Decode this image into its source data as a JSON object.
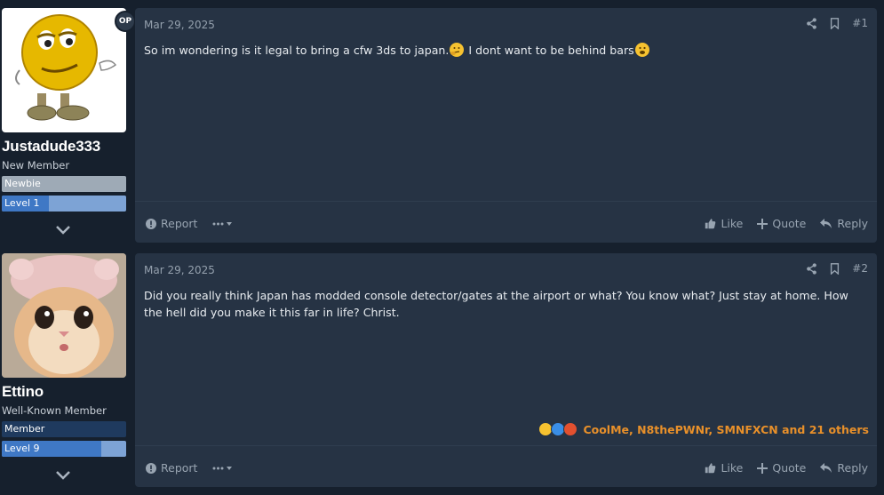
{
  "posts": [
    {
      "author": {
        "name": "Justadude333",
        "title": "New Member",
        "banner": "Newbie",
        "banner_color": "#9eaab6",
        "level": "Level 1",
        "level_progress": 0.38,
        "op_badge": "OP",
        "avatar": "yellow-smiley-avatar"
      },
      "date": "Mar 29, 2025",
      "number": "#1",
      "text_parts": [
        "So im wondering is it legal to bring a cfw 3ds to japan.",
        " I dont want to be behind bars"
      ],
      "reactions": null,
      "actions": {
        "report": "Report",
        "like": "Like",
        "quote": "Quote",
        "reply": "Reply"
      }
    },
    {
      "author": {
        "name": "Ettino",
        "title": "Well-Known Member",
        "banner": "Member",
        "banner_color": "#1f3a5e",
        "level": "Level 9",
        "level_progress": 0.8,
        "op_badge": "",
        "avatar": "cat-avatar"
      },
      "date": "Mar 29, 2025",
      "number": "#2",
      "text": "Did you really think Japan has modded console detector/gates at the airport or what? You know what? Just stay at home. How the hell did you make it this far in life? Christ.",
      "reactions": {
        "text": "CoolMe, N8thePWNr, SMNFXCN and 21 others",
        "icons": [
          "laugh-emoji-icon",
          "like-emoji-icon",
          "angry-emoji-icon"
        ]
      },
      "actions": {
        "report": "Report",
        "like": "Like",
        "quote": "Quote",
        "reply": "Reply"
      }
    }
  ],
  "colors": {
    "accent": "#e8902a",
    "card": "#263344",
    "background": "#16202d"
  }
}
